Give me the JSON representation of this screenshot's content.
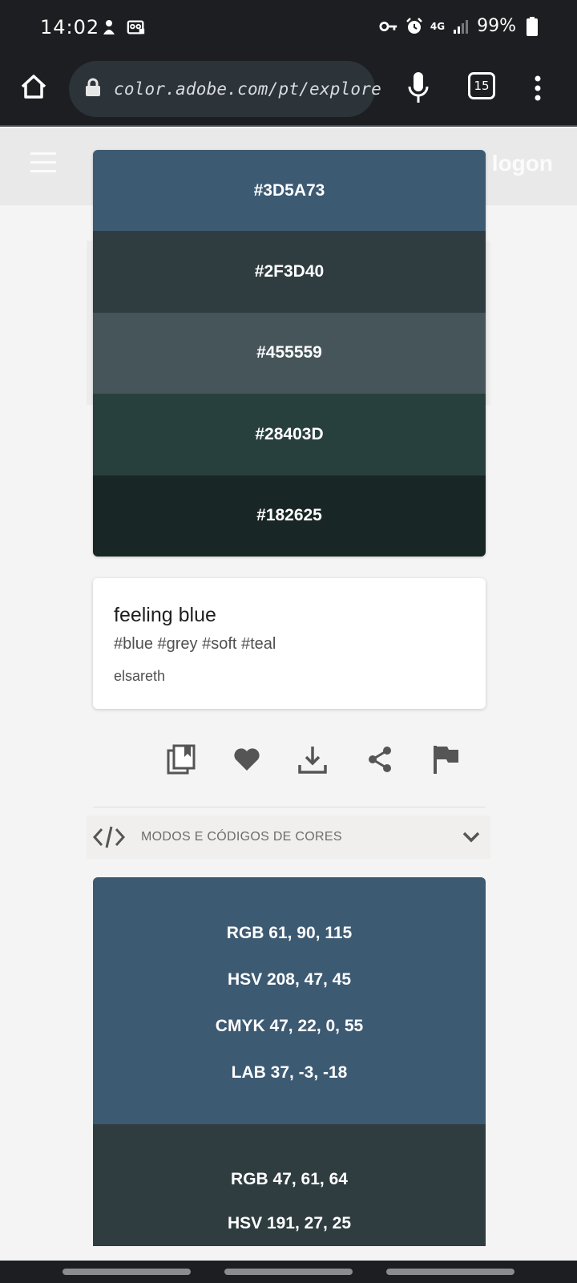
{
  "status_bar": {
    "time": "14:02",
    "network": "4G",
    "battery": "99%"
  },
  "browser": {
    "url": "color.adobe.com/pt/explore",
    "tab_count": "15"
  },
  "header": {
    "logon_label": "logon"
  },
  "palette": {
    "colors": [
      {
        "hex": "#3D5A73"
      },
      {
        "hex": "#2F3D40"
      },
      {
        "hex": "#455559"
      },
      {
        "hex": "#28403D"
      },
      {
        "hex": "#182625"
      }
    ]
  },
  "theme": {
    "title": "feeling blue",
    "tags": "#blue #grey #soft #teal",
    "author": "elsareth"
  },
  "actions": {
    "icons": [
      "copy-to-library-icon",
      "heart-icon",
      "download-icon",
      "share-icon",
      "flag-icon"
    ]
  },
  "codes_section": {
    "label": "MODOS E CÓDIGOS DE CORES"
  },
  "color_codes": [
    {
      "rgb": "RGB 61, 90, 115",
      "hsv": "HSV 208, 47, 45",
      "cmyk": "CMYK 47, 22, 0, 55",
      "lab": "LAB 37, -3, -18"
    },
    {
      "rgb": "RGB 47, 61, 64",
      "hsv": "HSV 191, 27, 25"
    }
  ]
}
